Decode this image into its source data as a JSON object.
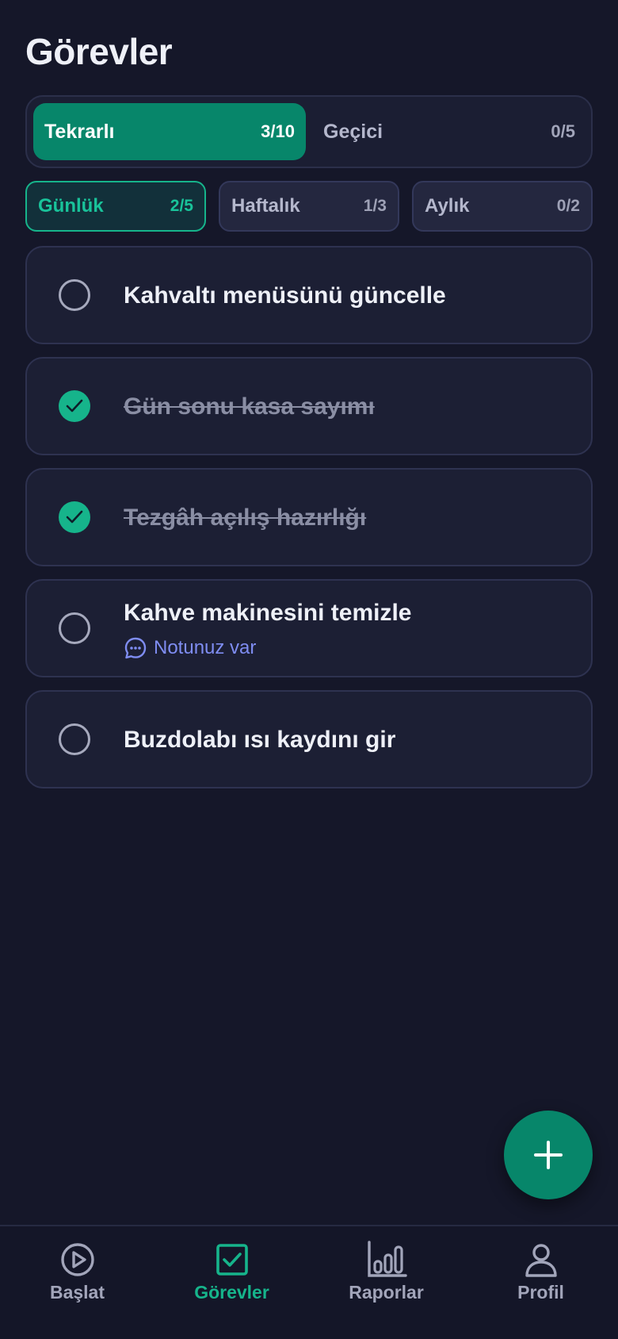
{
  "header": {
    "title": "Görevler"
  },
  "segments": [
    {
      "label": "Tekrarlı",
      "count": "3/10",
      "active": true
    },
    {
      "label": "Geçici",
      "count": "0/5",
      "active": false
    }
  ],
  "periods": [
    {
      "label": "Günlük",
      "count": "2/5",
      "active": true
    },
    {
      "label": "Haftalık",
      "count": "1/3",
      "active": false
    },
    {
      "label": "Aylık",
      "count": "0/2",
      "active": false
    }
  ],
  "tasks": [
    {
      "text": "Kahvaltı menüsünü güncelle",
      "done": false
    },
    {
      "text": "Gün sonu kasa sayımı",
      "done": true
    },
    {
      "text": "Tezgâh açılış hazırlığı",
      "done": true
    },
    {
      "text": "Kahve makinesini temizle",
      "done": false,
      "note": "Notunuz var"
    },
    {
      "text": "Buzdolabı ısı kaydını gir",
      "done": false
    }
  ],
  "fab": {
    "icon": "plus-icon"
  },
  "nav": [
    {
      "label": "Başlat",
      "icon": "play-circle-icon",
      "active": false
    },
    {
      "label": "Görevler",
      "icon": "checkbox-icon",
      "active": true
    },
    {
      "label": "Raporlar",
      "icon": "bar-chart-icon",
      "active": false
    },
    {
      "label": "Profil",
      "icon": "user-icon",
      "active": false
    }
  ],
  "colors": {
    "background": "#151729",
    "accent": "#07866a",
    "accent_bright": "#16b48b",
    "note": "#7f8df2"
  }
}
